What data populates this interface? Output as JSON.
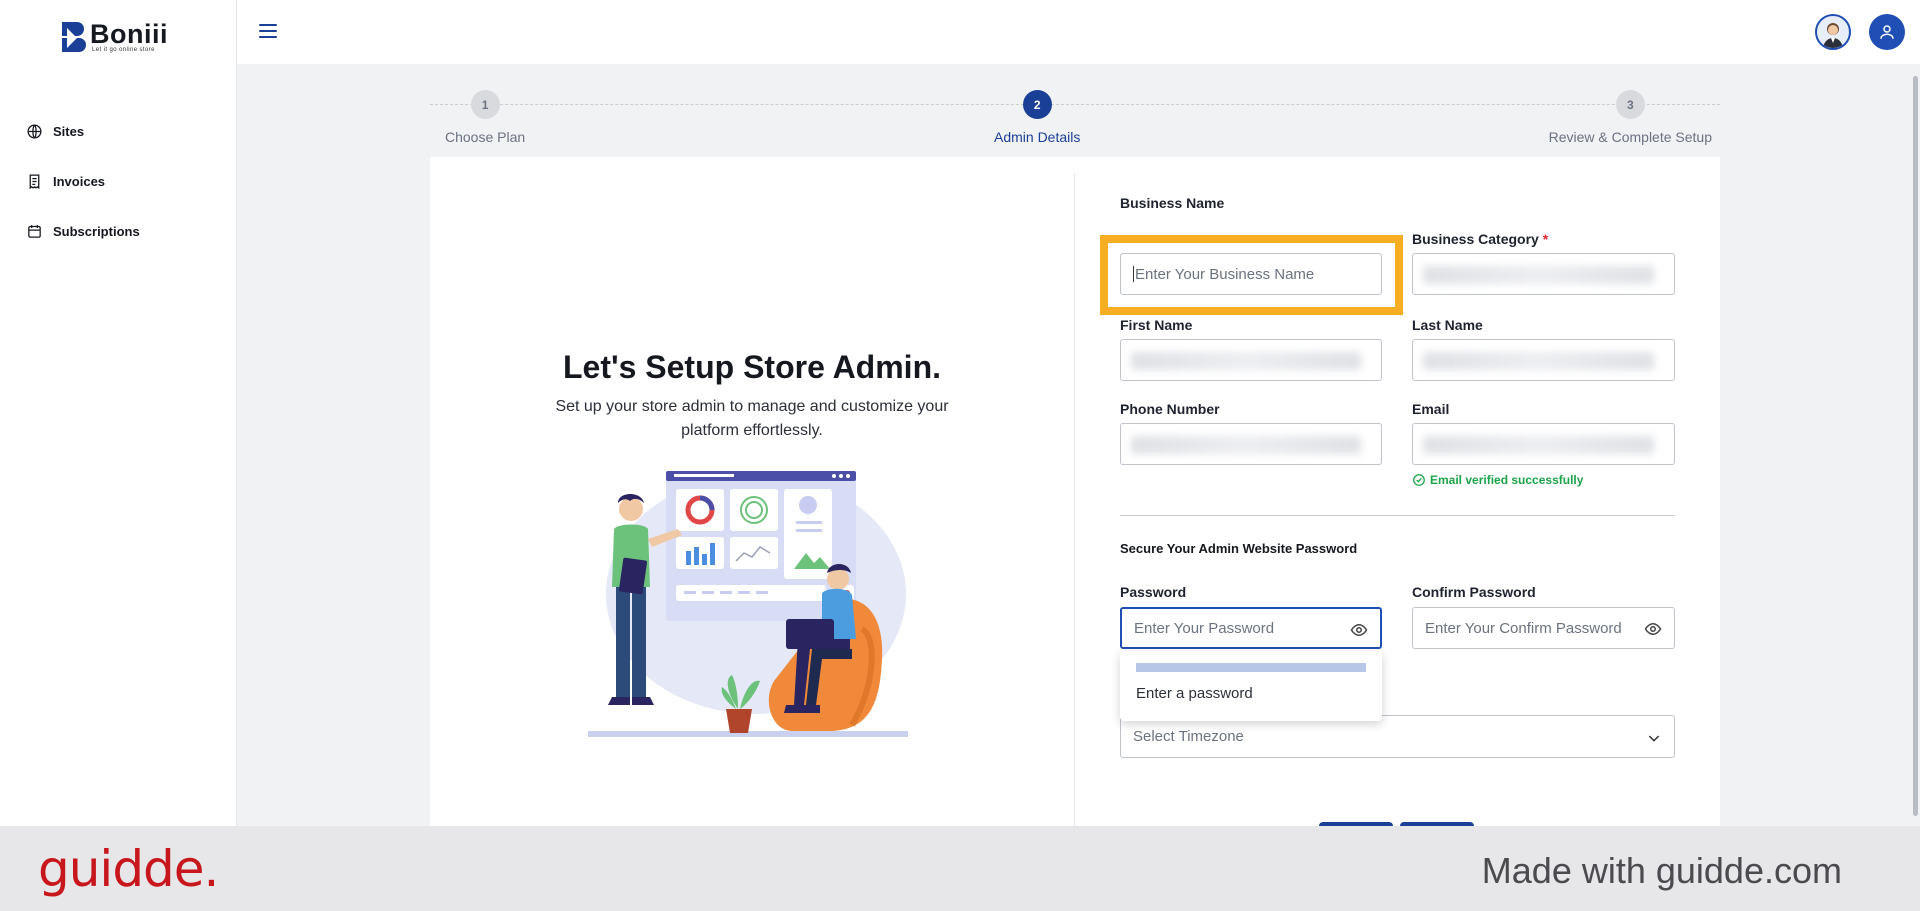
{
  "brand": {
    "name": "Boniii",
    "tagline": "Let it go online store"
  },
  "sidebar": {
    "items": [
      {
        "label": "Sites",
        "icon": "globe-icon"
      },
      {
        "label": "Invoices",
        "icon": "invoice-icon"
      },
      {
        "label": "Subscriptions",
        "icon": "calendar-icon"
      }
    ]
  },
  "stepper": {
    "steps": [
      {
        "number": "1",
        "label": "Choose Plan",
        "active": false
      },
      {
        "number": "2",
        "label": "Admin Details",
        "active": true
      },
      {
        "number": "3",
        "label": "Review & Complete Setup",
        "active": false
      }
    ]
  },
  "hero": {
    "title": "Let's Setup Store Admin.",
    "subtitle": "Set up your store admin to manage and customize your platform effortlessly."
  },
  "form": {
    "business_name": {
      "label": "Business Name",
      "placeholder": "Enter Your Business Name"
    },
    "business_category": {
      "label": "Business Category",
      "required_mark": "*"
    },
    "first_name": {
      "label": "First Name"
    },
    "last_name": {
      "label": "Last Name"
    },
    "phone": {
      "label": "Phone Number"
    },
    "email": {
      "label": "Email",
      "verified_text": "Email verified successfully"
    },
    "password_section_title": "Secure Your Admin Website Password",
    "password": {
      "label": "Password",
      "placeholder": "Enter Your Password"
    },
    "confirm_password": {
      "label": "Confirm Password",
      "placeholder": "Enter Your Confirm Password"
    },
    "password_hint": "Enter a password",
    "timezone": {
      "placeholder": "Select Timezone"
    }
  },
  "footer": {
    "logo": "guidde.",
    "made_with": "Made with guidde.com"
  },
  "colors": {
    "primary": "#1a3f96",
    "highlight": "#f7ad22",
    "success": "#1ca34a",
    "required": "#e0242e",
    "guidde_red": "#c8161d"
  }
}
